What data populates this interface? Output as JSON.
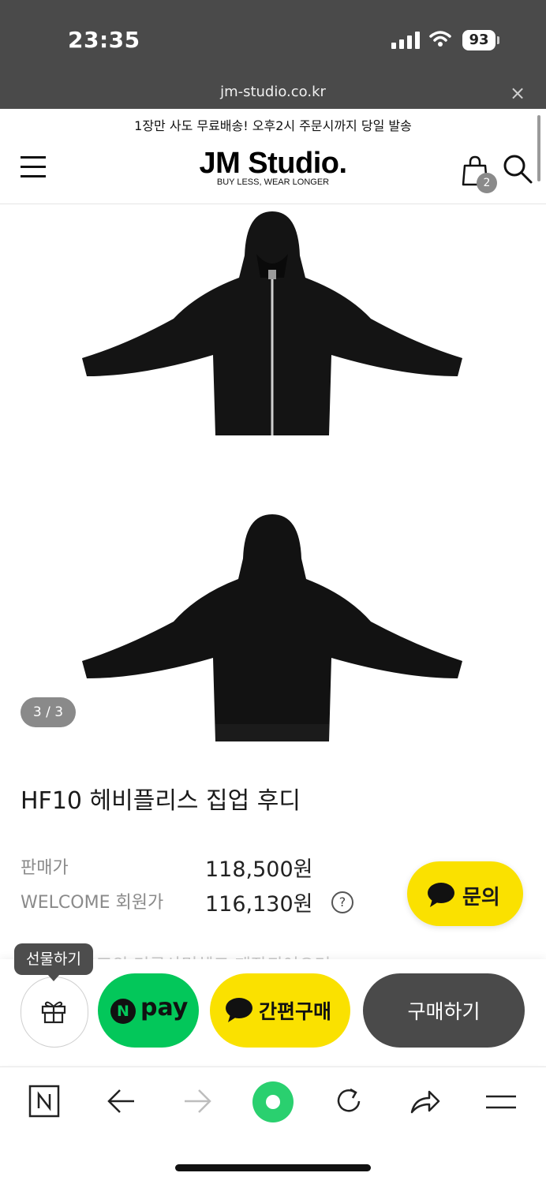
{
  "status_bar": {
    "time": "23:35",
    "battery": "93"
  },
  "url_bar": {
    "url": "jm-studio.co.kr",
    "close": "×"
  },
  "promo": {
    "text": "1장만 사도 무료배송! 오후2시 주문시까지 당일 발송"
  },
  "header": {
    "logo": "JM Studio.",
    "tagline": "BUY LESS, WEAR LONGER",
    "cart_count": "2",
    "icons": [
      "hamburger-menu-icon",
      "shopping-bag-icon",
      "search-icon"
    ]
  },
  "gallery": {
    "counter": "3 / 3"
  },
  "product": {
    "title": "HF10 헤비플리스 집업 후디",
    "price_label": "판매가",
    "price": "118,500원",
    "member_label": "WELCOME 회원가",
    "member_price": "116,130원",
    "help": "?",
    "desc_partial": "했으 14온즈의 미국사면헤크 제작되어으며"
  },
  "inquiry_button": {
    "label": "문의"
  },
  "action_bar": {
    "gift_tooltip": "선물하기",
    "npay_n": "N",
    "npay_label": "pay",
    "kakao_label": "간편구매",
    "buy_label": "구매하기"
  },
  "colors": {
    "kakao_yellow": "#fae100",
    "naver_green": "#03c75a",
    "dark_button": "#4a4a4a",
    "status_bar": "#4a4a4a"
  }
}
